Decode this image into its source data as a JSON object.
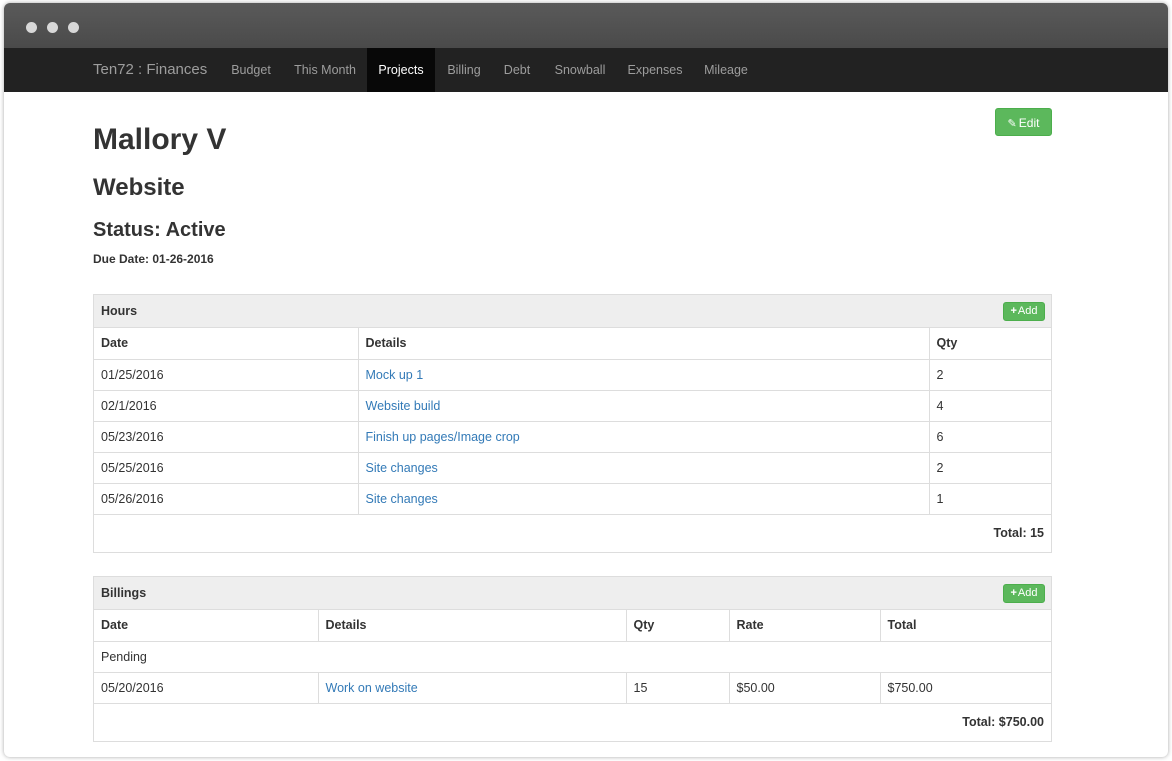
{
  "navbar": {
    "brand": "Ten72 : Finances",
    "items": [
      {
        "label": "Budget",
        "active": false
      },
      {
        "label": "This Month",
        "active": false
      },
      {
        "label": "Projects",
        "active": true
      },
      {
        "label": "Billing",
        "active": false
      },
      {
        "label": "Debt",
        "active": false
      },
      {
        "label": "Snowball",
        "active": false
      },
      {
        "label": "Expenses",
        "active": false
      },
      {
        "label": "Mileage",
        "active": false
      }
    ]
  },
  "page": {
    "edit_label": "Edit",
    "client": "Mallory V",
    "project": "Website",
    "status": "Status: Active",
    "due_date": "Due Date: 01-26-2016"
  },
  "hours": {
    "title": "Hours",
    "add_label": "Add",
    "columns": [
      "Date",
      "Details",
      "Qty"
    ],
    "rows": [
      {
        "date": "01/25/2016",
        "details": "Mock up 1",
        "qty": "2"
      },
      {
        "date": "02/1/2016",
        "details": "Website build",
        "qty": "4"
      },
      {
        "date": "05/23/2016",
        "details": "Finish up pages/Image crop",
        "qty": "6"
      },
      {
        "date": "05/25/2016",
        "details": "Site changes",
        "qty": "2"
      },
      {
        "date": "05/26/2016",
        "details": "Site changes",
        "qty": "1"
      }
    ],
    "total": "Total: 15"
  },
  "billings": {
    "title": "Billings",
    "add_label": "Add",
    "columns": [
      "Date",
      "Details",
      "Qty",
      "Rate",
      "Total"
    ],
    "group_label": "Pending",
    "rows": [
      {
        "date": "05/20/2016",
        "details": "Work on website",
        "qty": "15",
        "rate": "$50.00",
        "total": "$750.00"
      }
    ],
    "total": "Total: $750.00"
  },
  "colors": {
    "navbar_bg": "#222222",
    "success": "#5cb85c",
    "link": "#337ab7",
    "panel_heading": "#eeeeee"
  }
}
